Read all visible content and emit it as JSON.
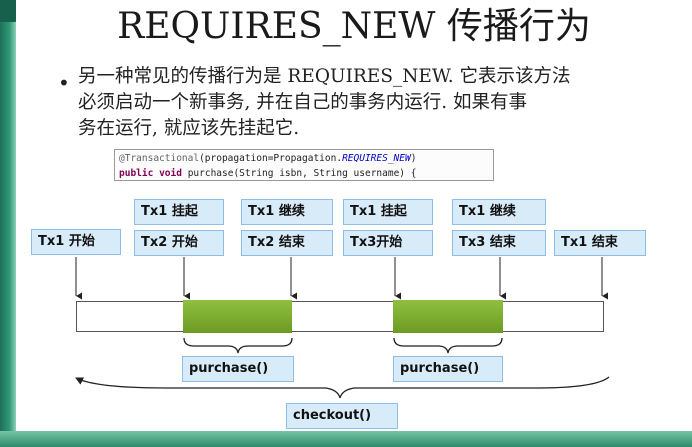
{
  "slide": {
    "title": "REQUIRES_NEW 传播行为",
    "bullet": "另一种常见的传播行为是 REQUIRES_NEW. 它表示该方法\n必须启动一个新事务, 并在自己的事务内运行. 如果有事\n务在运行, 就应该先挂起它."
  },
  "code": {
    "annotation": "@Transactional",
    "paren_open": "(propagation=Propagation.",
    "enum_value": "REQUIRES_NEW",
    "paren_close": ")",
    "kw_public": "public",
    "kw_void": "void",
    "signature": "purchase(String isbn, String username) {"
  },
  "labels": {
    "tx1_start": "Tx1 开始",
    "tx1_suspend_a": "Tx1 挂起",
    "tx2_start": "Tx2 开始",
    "tx1_resume_a": "Tx1 继续",
    "tx2_end": "Tx2 结束",
    "tx1_suspend_b": "Tx1 挂起",
    "tx3_start": "Tx3开始",
    "tx1_resume_b": "Tx1 继续",
    "tx3_end": "Tx3 结束",
    "tx1_end": "Tx1 结束",
    "purchase_a": "purchase()",
    "purchase_b": "purchase()",
    "checkout": "checkout()"
  },
  "colors": {
    "label_fill": "#d8ebf8",
    "label_border": "#8fbde6",
    "segment_green": "#7aab2e"
  }
}
